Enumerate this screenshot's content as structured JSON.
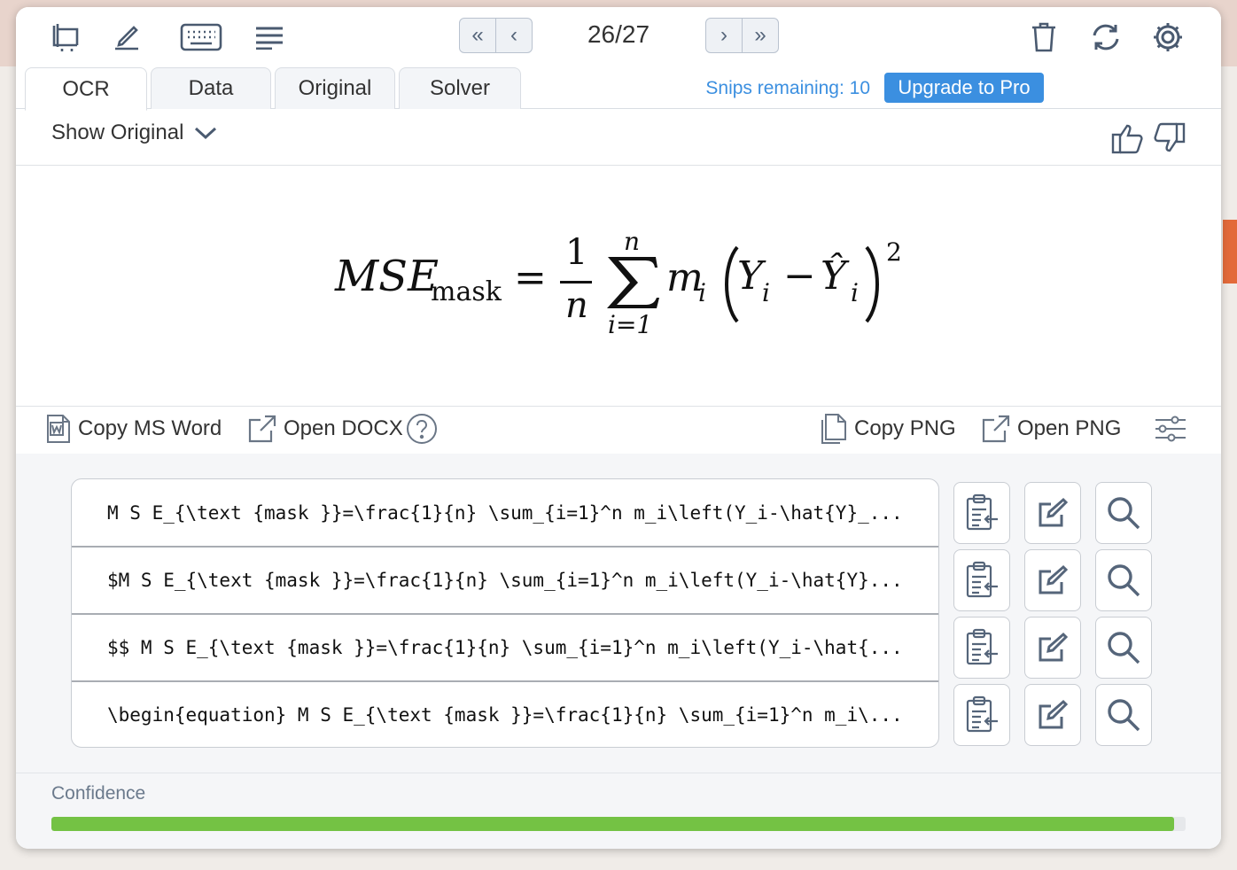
{
  "toolbar": {
    "counter": "26/27",
    "icons": [
      "crop-screen-icon",
      "pen-icon",
      "keyboard-icon",
      "menu-lines-icon",
      "trash-icon",
      "refresh-icon",
      "gear-icon"
    ],
    "nav": [
      "double-left-chevron-icon",
      "left-chevron-icon",
      "right-chevron-icon",
      "double-right-chevron-icon"
    ]
  },
  "tabs": [
    {
      "label": "OCR",
      "active": true
    },
    {
      "label": "Data",
      "active": false
    },
    {
      "label": "Original",
      "active": false
    },
    {
      "label": "Solver",
      "active": false
    }
  ],
  "header": {
    "snips_remaining": "Snips remaining: 10",
    "upgrade_label": "Upgrade to Pro"
  },
  "view": {
    "show_original": "Show Original"
  },
  "equation": {
    "lhs_main": "MSE",
    "lhs_sub": "mask",
    "equals": "=",
    "frac_num": "1",
    "frac_den": "n",
    "sum_upper": "n",
    "sum_lower": "i=1",
    "m": "m",
    "i": "i",
    "Y": "Y",
    "minus": "−",
    "Yhat": "Ŷ",
    "power": "2"
  },
  "actions": {
    "copy_ms_word": "Copy MS Word",
    "open_docx": "Open DOCX",
    "copy_png": "Copy PNG",
    "open_png": "Open PNG"
  },
  "results": [
    "M S E_{\\text {mask }}=\\frac{1}{n} \\sum_{i=1}^n m_i\\left(Y_i-\\hat{Y}_...",
    "$M S E_{\\text {mask }}=\\frac{1}{n} \\sum_{i=1}^n m_i\\left(Y_i-\\hat{Y}...",
    "$$ M S E_{\\text {mask }}=\\frac{1}{n} \\sum_{i=1}^n m_i\\left(Y_i-\\hat{...",
    "\\begin{equation} M S E_{\\text {mask }}=\\frac{1}{n} \\sum_{i=1}^n m_i\\..."
  ],
  "confidence": {
    "label": "Confidence",
    "value": 0.99,
    "color": "#74c244"
  },
  "colors": {
    "accent": "#3b8fe0"
  }
}
